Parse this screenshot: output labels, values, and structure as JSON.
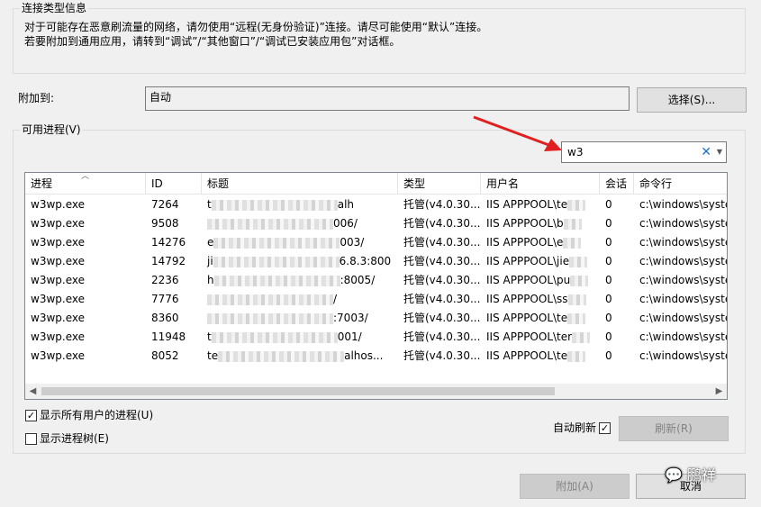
{
  "connection_info": {
    "title": "连接类型信息",
    "line1": "对于可能存在恶意刷流量的网络，请勿使用“远程(无身份验证)”连接。请尽可能使用“默认”连接。",
    "line2": "若要附加到通用应用，请转到“调试”/“其他窗口”/“调试已安装应用包”对话框。"
  },
  "attach_to": {
    "label": "附加到:",
    "value": "自动",
    "select_button": "选择(S)..."
  },
  "processes": {
    "title": "可用进程(V)",
    "search_value": "w3",
    "columns": [
      "进程",
      "ID",
      "标题",
      "类型",
      "用户名",
      "会话",
      "命令行"
    ],
    "rows": [
      {
        "process": "w3wp.exe",
        "id": "7264",
        "title": "t",
        "title_tail": "alh",
        "type": "托管(v4.0.30...",
        "user": "IIS APPPOOL\\te",
        "session": "0",
        "cmd": "c:\\windows\\syste"
      },
      {
        "process": "w3wp.exe",
        "id": "9508",
        "title": "",
        "title_tail": "006/",
        "type": "托管(v4.0.30...",
        "user": "IIS APPPOOL\\b",
        "session": "0",
        "cmd": "c:\\windows\\syste"
      },
      {
        "process": "w3wp.exe",
        "id": "14276",
        "title": "e",
        "title_tail": "003/",
        "type": "托管(v4.0.30...",
        "user": "IIS APPPOOL\\e",
        "session": "0",
        "cmd": "c:\\windows\\syste"
      },
      {
        "process": "w3wp.exe",
        "id": "14792",
        "title": "ji",
        "title_tail": "6.8.3:800",
        "type": "托管(v4.0.30...",
        "user": "IIS APPPOOL\\jie",
        "session": "0",
        "cmd": "c:\\windows\\syste"
      },
      {
        "process": "w3wp.exe",
        "id": "2236",
        "title": "h",
        "title_tail": ":8005/",
        "type": "托管(v4.0.30...",
        "user": "IIS APPPOOL\\pu",
        "session": "0",
        "cmd": "c:\\windows\\syste"
      },
      {
        "process": "w3wp.exe",
        "id": "7776",
        "title": "",
        "title_tail": "/",
        "type": "托管(v4.0.30...",
        "user": "IIS APPPOOL\\ss",
        "session": "0",
        "cmd": "c:\\windows\\syste"
      },
      {
        "process": "w3wp.exe",
        "id": "8360",
        "title": "",
        "title_tail": ":7003/",
        "type": "托管(v4.0.30...",
        "user": "IIS APPPOOL\\te",
        "session": "0",
        "cmd": "c:\\windows\\syste"
      },
      {
        "process": "w3wp.exe",
        "id": "11948",
        "title": "t",
        "title_tail": "001/",
        "type": "托管(v4.0.30...",
        "user": "IIS APPPOOL\\ter",
        "session": "0",
        "cmd": "c:\\windows\\syste"
      },
      {
        "process": "w3wp.exe",
        "id": "8052",
        "title": "te",
        "title_tail": "alhos...",
        "type": "托管(v4.0.30...",
        "user": "IIS APPPOOL\\te",
        "session": "0",
        "cmd": "c:\\windows\\syste"
      }
    ],
    "show_all_users": {
      "label": "显示所有用户的进程(U)",
      "checked": true
    },
    "show_tree": {
      "label": "显示进程树(E)",
      "checked": false
    },
    "auto_refresh": {
      "label": "自动刷新",
      "checked": true
    },
    "refresh_button": "刷新(R)"
  },
  "footer": {
    "attach_button": "附加(A)",
    "cancel_button": "取消"
  },
  "watermark": "鹏祥",
  "colors": {
    "arrow": "#e02020",
    "clear_x": "#1e6fd0"
  }
}
